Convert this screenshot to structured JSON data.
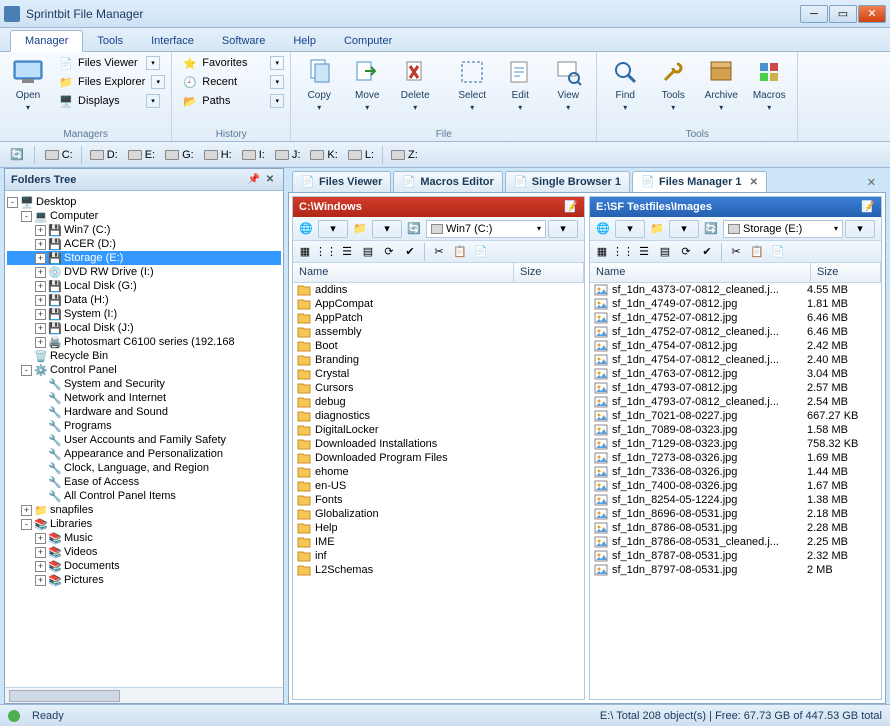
{
  "app": {
    "title": "Sprintbit File Manager"
  },
  "menutabs": [
    "Manager",
    "Tools",
    "Interface",
    "Software",
    "Help",
    "Computer"
  ],
  "ribbon": {
    "open": "Open",
    "files_viewer": "Files Viewer",
    "files_explorer": "Files Explorer",
    "displays": "Displays",
    "favorites": "Favorites",
    "recent": "Recent",
    "paths": "Paths",
    "copy": "Copy",
    "move": "Move",
    "delete": "Delete",
    "select": "Select",
    "edit": "Edit",
    "view": "View",
    "find": "Find",
    "tools": "Tools",
    "archive": "Archive",
    "macros": "Macros",
    "group_managers": "Managers",
    "group_history": "History",
    "group_file": "File",
    "group_tools": "Tools"
  },
  "drivebar": [
    "C:",
    "D:",
    "E:",
    "G:",
    "H:",
    "I:",
    "J:",
    "K:",
    "L:",
    "Z:"
  ],
  "tree_panel_title": "Folders Tree",
  "tree": [
    {
      "lvl": 0,
      "exp": "-",
      "icon": "desktop",
      "label": "Desktop"
    },
    {
      "lvl": 1,
      "exp": "-",
      "icon": "computer",
      "label": "Computer"
    },
    {
      "lvl": 2,
      "exp": "+",
      "icon": "disk",
      "label": "Win7 (C:)"
    },
    {
      "lvl": 2,
      "exp": "+",
      "icon": "disk",
      "label": "ACER (D:)"
    },
    {
      "lvl": 2,
      "exp": "+",
      "icon": "disk",
      "label": "Storage (E:)",
      "selected": true
    },
    {
      "lvl": 2,
      "exp": "+",
      "icon": "cd",
      "label": "DVD RW Drive (I:)"
    },
    {
      "lvl": 2,
      "exp": "+",
      "icon": "disk",
      "label": "Local Disk (G:)"
    },
    {
      "lvl": 2,
      "exp": "+",
      "icon": "disk",
      "label": "Data (H:)"
    },
    {
      "lvl": 2,
      "exp": "+",
      "icon": "disk",
      "label": "System (I:)"
    },
    {
      "lvl": 2,
      "exp": "+",
      "icon": "disk",
      "label": "Local Disk (J:)"
    },
    {
      "lvl": 2,
      "exp": "+",
      "icon": "printer",
      "label": "Photosmart C6100 series (192.168"
    },
    {
      "lvl": 1,
      "exp": " ",
      "icon": "recycle",
      "label": "Recycle Bin"
    },
    {
      "lvl": 1,
      "exp": "-",
      "icon": "cpanel",
      "label": "Control Panel"
    },
    {
      "lvl": 2,
      "exp": " ",
      "icon": "cp",
      "label": "System and Security"
    },
    {
      "lvl": 2,
      "exp": " ",
      "icon": "cp",
      "label": "Network and Internet"
    },
    {
      "lvl": 2,
      "exp": " ",
      "icon": "cp",
      "label": "Hardware and Sound"
    },
    {
      "lvl": 2,
      "exp": " ",
      "icon": "cp",
      "label": "Programs"
    },
    {
      "lvl": 2,
      "exp": " ",
      "icon": "cp",
      "label": "User Accounts and Family Safety"
    },
    {
      "lvl": 2,
      "exp": " ",
      "icon": "cp",
      "label": "Appearance and Personalization"
    },
    {
      "lvl": 2,
      "exp": " ",
      "icon": "cp",
      "label": "Clock, Language, and Region"
    },
    {
      "lvl": 2,
      "exp": " ",
      "icon": "cp",
      "label": "Ease of Access"
    },
    {
      "lvl": 2,
      "exp": " ",
      "icon": "cp",
      "label": "All Control Panel Items"
    },
    {
      "lvl": 1,
      "exp": "+",
      "icon": "folder",
      "label": "snapfiles"
    },
    {
      "lvl": 1,
      "exp": "-",
      "icon": "lib",
      "label": "Libraries"
    },
    {
      "lvl": 2,
      "exp": "+",
      "icon": "lib",
      "label": "Music"
    },
    {
      "lvl": 2,
      "exp": "+",
      "icon": "lib",
      "label": "Videos"
    },
    {
      "lvl": 2,
      "exp": "+",
      "icon": "lib",
      "label": "Documents"
    },
    {
      "lvl": 2,
      "exp": "+",
      "icon": "lib",
      "label": "Pictures"
    }
  ],
  "file_tabs": [
    {
      "label": "Files Viewer",
      "icon": "viewer"
    },
    {
      "label": "Macros Editor",
      "icon": "macros"
    },
    {
      "label": "Single Browser 1",
      "icon": "browser"
    },
    {
      "label": "Files Manager 1",
      "icon": "manager",
      "active": true
    }
  ],
  "left_pane": {
    "path": "C:\\Windows",
    "drive_label": "Win7 (C:)",
    "name_col": "Name",
    "size_col": "Size",
    "items": [
      {
        "name": "addins",
        "type": "folder"
      },
      {
        "name": "AppCompat",
        "type": "folder"
      },
      {
        "name": "AppPatch",
        "type": "folder"
      },
      {
        "name": "assembly",
        "type": "folder"
      },
      {
        "name": "Boot",
        "type": "folder"
      },
      {
        "name": "Branding",
        "type": "folder"
      },
      {
        "name": "Crystal",
        "type": "folder"
      },
      {
        "name": "Cursors",
        "type": "folder"
      },
      {
        "name": "debug",
        "type": "folder"
      },
      {
        "name": "diagnostics",
        "type": "folder"
      },
      {
        "name": "DigitalLocker",
        "type": "folder"
      },
      {
        "name": "Downloaded Installations",
        "type": "folder"
      },
      {
        "name": "Downloaded Program Files",
        "type": "folder"
      },
      {
        "name": "ehome",
        "type": "folder"
      },
      {
        "name": "en-US",
        "type": "folder"
      },
      {
        "name": "Fonts",
        "type": "folder"
      },
      {
        "name": "Globalization",
        "type": "folder"
      },
      {
        "name": "Help",
        "type": "folder"
      },
      {
        "name": "IME",
        "type": "folder"
      },
      {
        "name": "inf",
        "type": "folder"
      },
      {
        "name": "L2Schemas",
        "type": "folder"
      }
    ]
  },
  "right_pane": {
    "path": "E:\\SF Testfiles\\Images",
    "drive_label": "Storage (E:)",
    "name_col": "Name",
    "size_col": "Size",
    "items": [
      {
        "name": "sf_1dn_4373-07-0812_cleaned.j...",
        "size": "4.55 MB",
        "type": "img"
      },
      {
        "name": "sf_1dn_4749-07-0812.jpg",
        "size": "1.81 MB",
        "type": "img"
      },
      {
        "name": "sf_1dn_4752-07-0812.jpg",
        "size": "6.46 MB",
        "type": "img"
      },
      {
        "name": "sf_1dn_4752-07-0812_cleaned.j...",
        "size": "6.46 MB",
        "type": "img"
      },
      {
        "name": "sf_1dn_4754-07-0812.jpg",
        "size": "2.42 MB",
        "type": "img"
      },
      {
        "name": "sf_1dn_4754-07-0812_cleaned.j...",
        "size": "2.40 MB",
        "type": "img"
      },
      {
        "name": "sf_1dn_4763-07-0812.jpg",
        "size": "3.04 MB",
        "type": "img"
      },
      {
        "name": "sf_1dn_4793-07-0812.jpg",
        "size": "2.57 MB",
        "type": "img"
      },
      {
        "name": "sf_1dn_4793-07-0812_cleaned.j...",
        "size": "2.54 MB",
        "type": "img"
      },
      {
        "name": "sf_1dn_7021-08-0227.jpg",
        "size": "667.27 KB",
        "type": "img"
      },
      {
        "name": "sf_1dn_7089-08-0323.jpg",
        "size": "1.58 MB",
        "type": "img"
      },
      {
        "name": "sf_1dn_7129-08-0323.jpg",
        "size": "758.32 KB",
        "type": "img"
      },
      {
        "name": "sf_1dn_7273-08-0326.jpg",
        "size": "1.69 MB",
        "type": "img"
      },
      {
        "name": "sf_1dn_7336-08-0326.jpg",
        "size": "1.44 MB",
        "type": "img"
      },
      {
        "name": "sf_1dn_7400-08-0326.jpg",
        "size": "1.67 MB",
        "type": "img"
      },
      {
        "name": "sf_1dn_8254-05-1224.jpg",
        "size": "1.38 MB",
        "type": "img"
      },
      {
        "name": "sf_1dn_8696-08-0531.jpg",
        "size": "2.18 MB",
        "type": "img"
      },
      {
        "name": "sf_1dn_8786-08-0531.jpg",
        "size": "2.28 MB",
        "type": "img"
      },
      {
        "name": "sf_1dn_8786-08-0531_cleaned.j...",
        "size": "2.25 MB",
        "type": "img"
      },
      {
        "name": "sf_1dn_8787-08-0531.jpg",
        "size": "2.32 MB",
        "type": "img"
      },
      {
        "name": "sf_1dn_8797-08-0531.jpg",
        "size": "2 MB",
        "type": "img"
      }
    ]
  },
  "statusbar": {
    "ready": "Ready",
    "summary": "E:\\ Total 208 object(s) | Free: 67.73 GB of 447.53 GB total"
  }
}
